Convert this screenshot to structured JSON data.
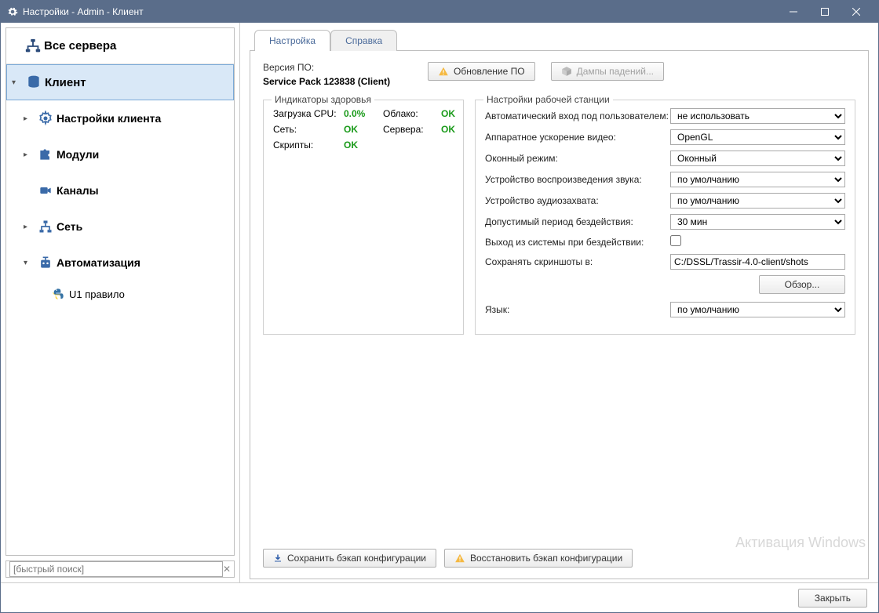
{
  "window": {
    "title": "Настройки - Admin - Клиент"
  },
  "sidebar": {
    "top": "Все сервера",
    "items": [
      {
        "label": "Клиент"
      },
      {
        "label": "Настройки клиента"
      },
      {
        "label": "Модули"
      },
      {
        "label": "Каналы"
      },
      {
        "label": "Сеть"
      },
      {
        "label": "Автоматизация"
      },
      {
        "label": "U1 правило"
      }
    ],
    "search_placeholder": "[быстрый поиск]"
  },
  "tabs": {
    "settings": "Настройка",
    "help": "Справка"
  },
  "version": {
    "label": "Версия ПО:",
    "value": "Service Pack 123838 (Client)"
  },
  "buttons": {
    "update": "Обновление ПО",
    "dumps": "Дампы падений...",
    "save_backup": "Сохранить бэкап конфигурации",
    "restore_backup": "Восстановить бэкап конфигурации",
    "browse": "Обзор...",
    "close": "Закрыть"
  },
  "health": {
    "title": "Индикаторы здоровья",
    "cpu_label": "Загрузка CPU:",
    "cpu_value": "0.0%",
    "cloud_label": "Облако:",
    "cloud_value": "OK",
    "net_label": "Сеть:",
    "net_value": "OK",
    "servers_label": "Сервера:",
    "servers_value": "OK",
    "scripts_label": "Скрипты:",
    "scripts_value": "OK"
  },
  "ws": {
    "title": "Настройки рабочей станции",
    "autologin_label": "Автоматический вход под пользователем:",
    "autologin_value": "не использовать",
    "hwaccel_label": "Аппаратное ускорение видео:",
    "hwaccel_value": "OpenGL",
    "window_label": "Оконный режим:",
    "window_value": "Оконный",
    "playback_label": "Устройство воспроизведения звука:",
    "playback_value": "по умолчанию",
    "capture_label": "Устройство аудиозахвата:",
    "capture_value": "по умолчанию",
    "idle_label": "Допустимый период бездействия:",
    "idle_value": "30 мин",
    "logout_idle_label": "Выход из системы при бездействии:",
    "shots_label": "Сохранять скриншоты в:",
    "shots_value": "C:/DSSL/Trassir-4.0-client/shots",
    "lang_label": "Язык:",
    "lang_value": "по умолчанию"
  },
  "watermark": "Активация Windows"
}
